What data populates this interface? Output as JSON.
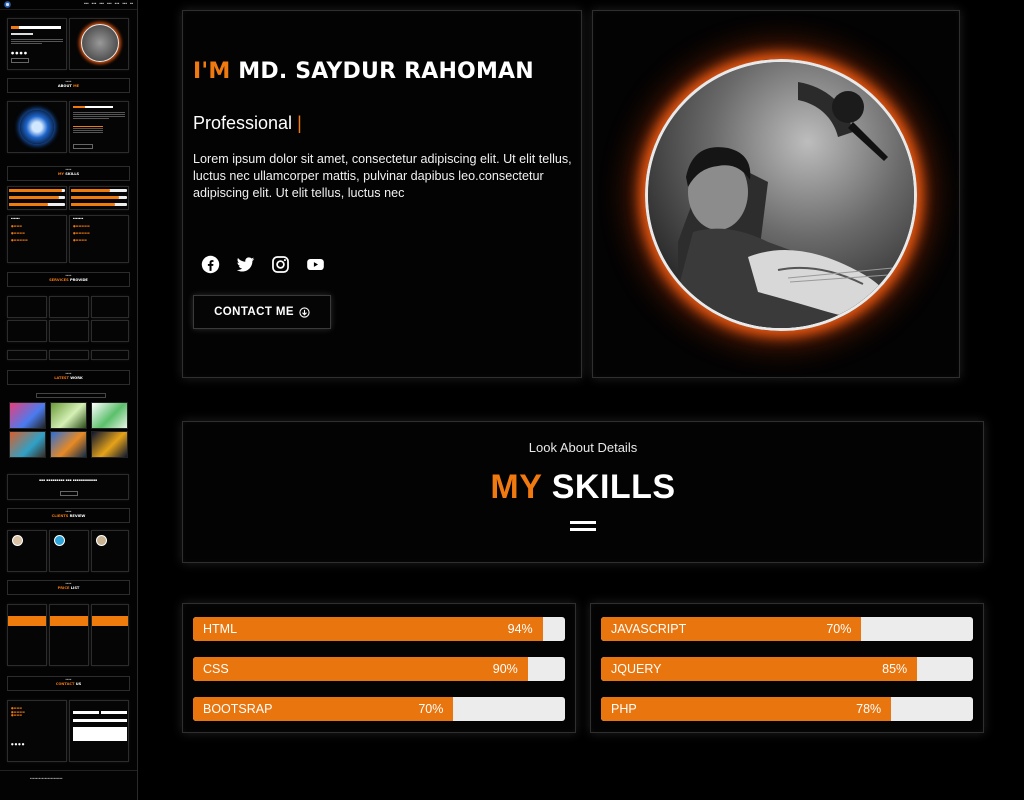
{
  "hero": {
    "greeting": "I'M",
    "name": "MD. SAYDUR RAHOMAN",
    "role": "Professional",
    "cursor": "|",
    "description": "Lorem ipsum dolor sit amet, consectetur adipiscing elit. Ut elit tellus, luctus nec ullamcorper mattis, pulvinar dapibus leo.consectetur adipiscing elit. Ut elit tellus, luctus nec",
    "socials": [
      "facebook-icon",
      "twitter-icon",
      "instagram-icon",
      "youtube-icon"
    ],
    "contact_button": "CONTACT ME"
  },
  "skills_section": {
    "subtitle": "Look About Details",
    "title_accent": "MY",
    "title_rest": "SKILLS"
  },
  "skills": {
    "left": [
      {
        "name": "HTML",
        "percent": 94,
        "label": "94%"
      },
      {
        "name": "CSS",
        "percent": 90,
        "label": "90%"
      },
      {
        "name": "BOOTSRAP",
        "percent": 70,
        "label": "70%"
      }
    ],
    "right": [
      {
        "name": "JAVASCRIPT",
        "percent": 70,
        "label": "70%"
      },
      {
        "name": "JQUERY",
        "percent": 85,
        "label": "85%"
      },
      {
        "name": "PHP",
        "percent": 78,
        "label": "78%"
      }
    ]
  },
  "colors": {
    "accent": "#f07a10",
    "bar_fill": "#e8750d",
    "bar_track": "#ececec",
    "background": "#000000"
  }
}
